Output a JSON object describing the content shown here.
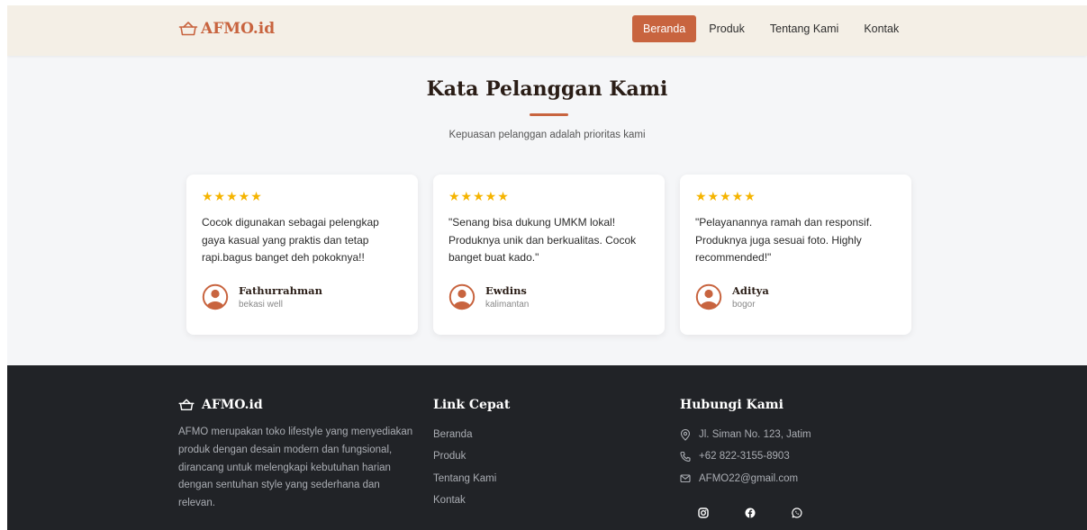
{
  "brand": {
    "name": "AFMO.id",
    "accent": "#c8643f"
  },
  "nav": {
    "items": [
      {
        "label": "Beranda",
        "active": true
      },
      {
        "label": "Produk",
        "active": false
      },
      {
        "label": "Tentang Kami",
        "active": false
      },
      {
        "label": "Kontak",
        "active": false
      }
    ]
  },
  "testimonials": {
    "title": "Kata Pelanggan Kami",
    "subtitle": "Kepuasan pelanggan adalah prioritas kami",
    "cards": [
      {
        "rating": 5,
        "stars": "★★★★★",
        "quote": "Cocok digunakan sebagai pelengkap gaya kasual yang praktis dan tetap rapi.bagus banget deh pokoknya!!",
        "name": "Fathurrahman",
        "location": "bekasi well"
      },
      {
        "rating": 5,
        "stars": "★★★★★",
        "quote": "\"Senang bisa dukung UMKM lokal! Produknya unik dan berkualitas. Cocok banget buat kado.\"",
        "name": "Ewdins",
        "location": "kalimantan"
      },
      {
        "rating": 5,
        "stars": "★★★★★",
        "quote": "\"Pelayanannya ramah dan responsif. Produknya juga sesuai foto. Highly recommended!\"",
        "name": "Aditya",
        "location": "bogor"
      }
    ]
  },
  "footer": {
    "about": {
      "title": "AFMO.id",
      "description": "AFMO merupakan toko lifestyle yang menyediakan produk dengan desain modern dan fungsional, dirancang untuk melengkapi kebutuhan harian dengan sentuhan style yang sederhana dan relevan."
    },
    "quick_links": {
      "title": "Link Cepat",
      "items": [
        "Beranda",
        "Produk",
        "Tentang Kami",
        "Kontak"
      ]
    },
    "contact": {
      "title": "Hubungi Kami",
      "address": "Jl. Siman No. 123, Jatim",
      "phone": "+62 822-3155-8903",
      "email": "AFMO22@gmail.com",
      "icons": [
        "location-pin-icon",
        "phone-icon",
        "mail-icon"
      ]
    },
    "socials": [
      "instagram-icon",
      "facebook-icon",
      "whatsapp-icon"
    ]
  }
}
